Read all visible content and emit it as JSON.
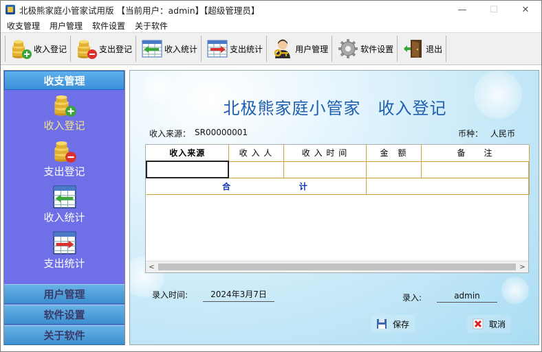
{
  "window": {
    "title": "北极熊家庭小管家试用版 【当前用户：admin】【超级管理员】",
    "controls": {
      "minimize": "—",
      "maximize": "☐",
      "close": "✕"
    }
  },
  "menu": [
    "收支管理",
    "用户管理",
    "软件设置",
    "关于软件"
  ],
  "toolbar": [
    {
      "label": "收入登记",
      "icon": "coins-add-icon"
    },
    {
      "label": "支出登记",
      "icon": "coins-remove-icon"
    },
    {
      "label": "收入统计",
      "icon": "income-stats-icon"
    },
    {
      "label": "支出统计",
      "icon": "expense-stats-icon"
    },
    {
      "label": "用户管理",
      "icon": "user-key-icon"
    },
    {
      "label": "软件设置",
      "icon": "gear-icon"
    },
    {
      "label": "退出",
      "icon": "exit-door-icon"
    }
  ],
  "sidebar": {
    "active_group": "收支管理",
    "items": [
      {
        "label": "收入登记",
        "icon": "coins-add-icon",
        "selected": true
      },
      {
        "label": "支出登记",
        "icon": "coins-remove-icon",
        "selected": false
      },
      {
        "label": "收入统计",
        "icon": "income-stats-icon",
        "selected": false
      },
      {
        "label": "支出统计",
        "icon": "expense-stats-icon",
        "selected": false
      }
    ],
    "groups": [
      "用户管理",
      "软件设置",
      "关于软件"
    ]
  },
  "form": {
    "title": "北极熊家庭小管家　收入登记",
    "source_label": "收入来源：",
    "source_value": "SR00000001",
    "currency_label": "币种：",
    "currency_value": "人民币",
    "columns": [
      "收入来源",
      "收 入 人",
      "收 入 时 间",
      "金　额",
      "备　　注"
    ],
    "total_label_1": "合",
    "total_label_2": "计",
    "date_label": "录入时间:",
    "date_value": "2024年3月7日",
    "entry_label": "录入:",
    "entry_value": "admin",
    "save_label": "保存",
    "cancel_label": "取消"
  },
  "colors": {
    "nav_bg": "#6f6fe8",
    "nav_header": "#3f91d2",
    "title_blue": "#1f5fb0",
    "grid_border": "#d5a040",
    "total_text": "#1030b8"
  }
}
